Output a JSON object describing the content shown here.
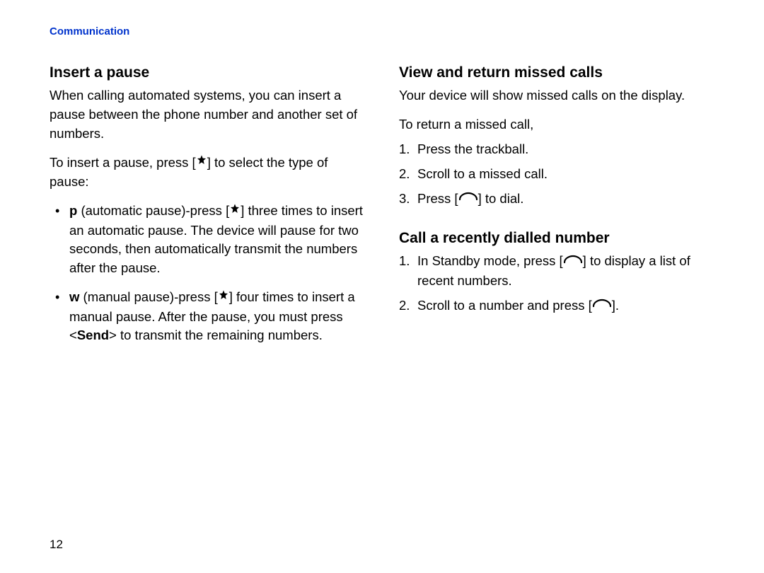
{
  "header": "Communication",
  "pageNumber": "12",
  "left": {
    "heading": "Insert a pause",
    "intro": "When calling automated systems, you can insert a pause between the phone number and another set of numbers.",
    "subintro_pre": "To insert a pause, press [",
    "subintro_post": "] to select the type of pause:",
    "bullets": [
      {
        "bold": "p",
        "pre": " (automatic pause)-press [",
        "post": "] three times to insert an automatic pause. The device will pause for two seconds, then automatically transmit the numbers after the pause."
      },
      {
        "bold": "w",
        "pre": " (manual pause)-press [",
        "post_a": "] four times to insert a manual pause. After the pause, you must press <",
        "send": "Send",
        "post_b": "> to transmit the remaining numbers."
      }
    ]
  },
  "right": {
    "heading1": "View and return missed calls",
    "p1": "Your device will show missed calls on the display.",
    "p2": "To return a missed call,",
    "steps1": [
      {
        "text": "Press the trackball."
      },
      {
        "text": "Scroll to a missed call."
      },
      {
        "pre": "Press [",
        "post": "] to dial."
      }
    ],
    "heading2": "Call a recently dialled number",
    "steps2": [
      {
        "pre": "In Standby mode, press [",
        "post": "] to display a list of recent numbers."
      },
      {
        "pre": "Scroll to a number and press [",
        "post": "]."
      }
    ]
  }
}
